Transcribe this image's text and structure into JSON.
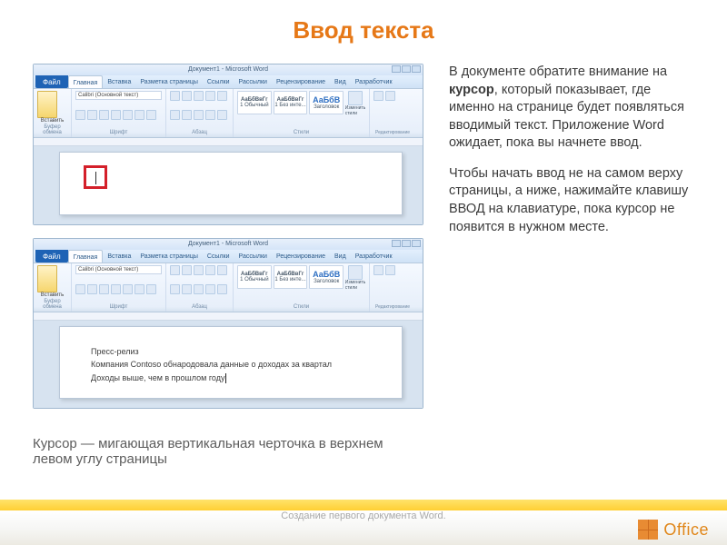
{
  "title": "Ввод текста",
  "body": {
    "p1a": "В документе обратите внимание на ",
    "p1b": "курсор",
    "p1c": ", который показывает, где именно на странице будет появляться вводимый текст. Приложение Word ожидает, пока вы начнете ввод.",
    "p2": "Чтобы начать ввод не на самом верху страницы, а ниже, нажимайте клавишу ВВОД на клавиатуре, пока курсор не появится в нужном месте."
  },
  "caption": "Курсор — мигающая вертикальная черточка в верхнем левом углу страницы",
  "footer": "Создание первого документа Word.",
  "logo_text": "Office",
  "word": {
    "win_title": "Документ1 - Microsoft Word",
    "tabs": {
      "file": "Файл",
      "home": "Главная",
      "insert": "Вставка",
      "layout": "Разметка страницы",
      "refs": "Ссылки",
      "mail": "Рассылки",
      "review": "Рецензирование",
      "view": "Вид",
      "dev": "Разработчик"
    },
    "ribbon": {
      "paste": "Вставить",
      "clipboard": "Буфер обмена",
      "font": "Шрифт",
      "font_name": "Calibri (Основной текст)",
      "paragraph": "Абзац",
      "style_big": "АаБбВвГг",
      "style_normal": "1 Обычный",
      "style_nospace": "1 Без инте...",
      "style_h": "АаБбВ",
      "style_heading": "Заголовок",
      "styles": "Стили",
      "change_styles": "Изменить стили",
      "editing": "Редактирование"
    },
    "doc2": {
      "l1": "Пресс-релиз",
      "l2": "Компания Contoso обнародовала данные о доходах за квартал",
      "l3": "Доходы выше, чем в прошлом году"
    }
  }
}
